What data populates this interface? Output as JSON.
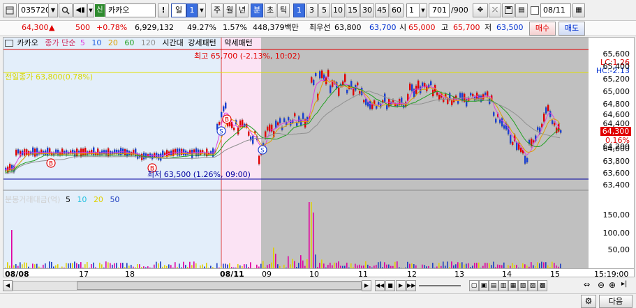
{
  "toolbar": {
    "code": "035720",
    "badge": "신",
    "name": "카카오",
    "alert": "!",
    "period_day": "일",
    "period_num": "1",
    "period_week": "주",
    "period_month": "월",
    "period_year": "년",
    "period_minute": "분",
    "period_second": "초",
    "period_tick": "틱",
    "intervals": [
      "1",
      "3",
      "5",
      "10",
      "15",
      "30",
      "45",
      "60"
    ],
    "interval_value": "1",
    "count_value": "701",
    "count_total": "/900",
    "date_value": "08/11"
  },
  "quote": {
    "price": "64,300",
    "arrow": "▲",
    "change": "500",
    "change_pct": "+0.78%",
    "volume": "6,929,132",
    "pct1": "49.27%",
    "pct2": "1.57%",
    "amount": "448,379백만",
    "priority_sell_label": "최우선",
    "priority_sell": "63,800",
    "priority_buy": "63,700",
    "open_label": "시",
    "open": "65,000",
    "high_label": "고",
    "high": "65,700",
    "low_label": "저",
    "low": "63,500",
    "buy_button": "매수",
    "sell_button": "매도"
  },
  "legend": {
    "stock": "카카오",
    "ma_label": "종가 단순",
    "ma_periods": [
      "5",
      "10",
      "20",
      "60",
      "120"
    ],
    "pattern_time": "시간대",
    "pattern_strong": "강세패턴",
    "pattern_weak": "약세패턴"
  },
  "annotations": {
    "high": "최고 65,700 (-2.13%, 10:02)",
    "low": "최저 63,500 (1.26%, 09:00)",
    "prev_close": "전일종가 63,800(0.78%)",
    "lc": "LC:1.26",
    "hc": "HC:-2.13",
    "current_price": "64,300",
    "current_pct": "0.16%"
  },
  "price_axis": [
    "65,600",
    "65,400",
    "65,200",
    "65,000",
    "64,800",
    "64,600",
    "64,400",
    "64,200",
    "64,000",
    "63,800",
    "63,600",
    "63,400"
  ],
  "volume_legend": {
    "title": "분봉거래대금(억)",
    "periods": [
      "5",
      "10",
      "20",
      "50"
    ]
  },
  "volume_axis": [
    "150,00",
    "100,00",
    "50,00"
  ],
  "time_axis": {
    "dates": [
      "08/08",
      "17",
      "18",
      "08/11",
      "09",
      "10",
      "11",
      "12",
      "13",
      "14",
      "15"
    ],
    "current_time": "15:19:00"
  },
  "bottom": {
    "next_button": "다음"
  },
  "colors": {
    "up": "#e00000",
    "down": "#1a3fd0",
    "prev_bg": "#e3eefa",
    "pink_bg": "#fbe3f4",
    "gray_bg": "#c0c0c0",
    "high_line": "#e00000",
    "prev_close_line": "#e0e000",
    "low_line": "#0000a0"
  }
}
